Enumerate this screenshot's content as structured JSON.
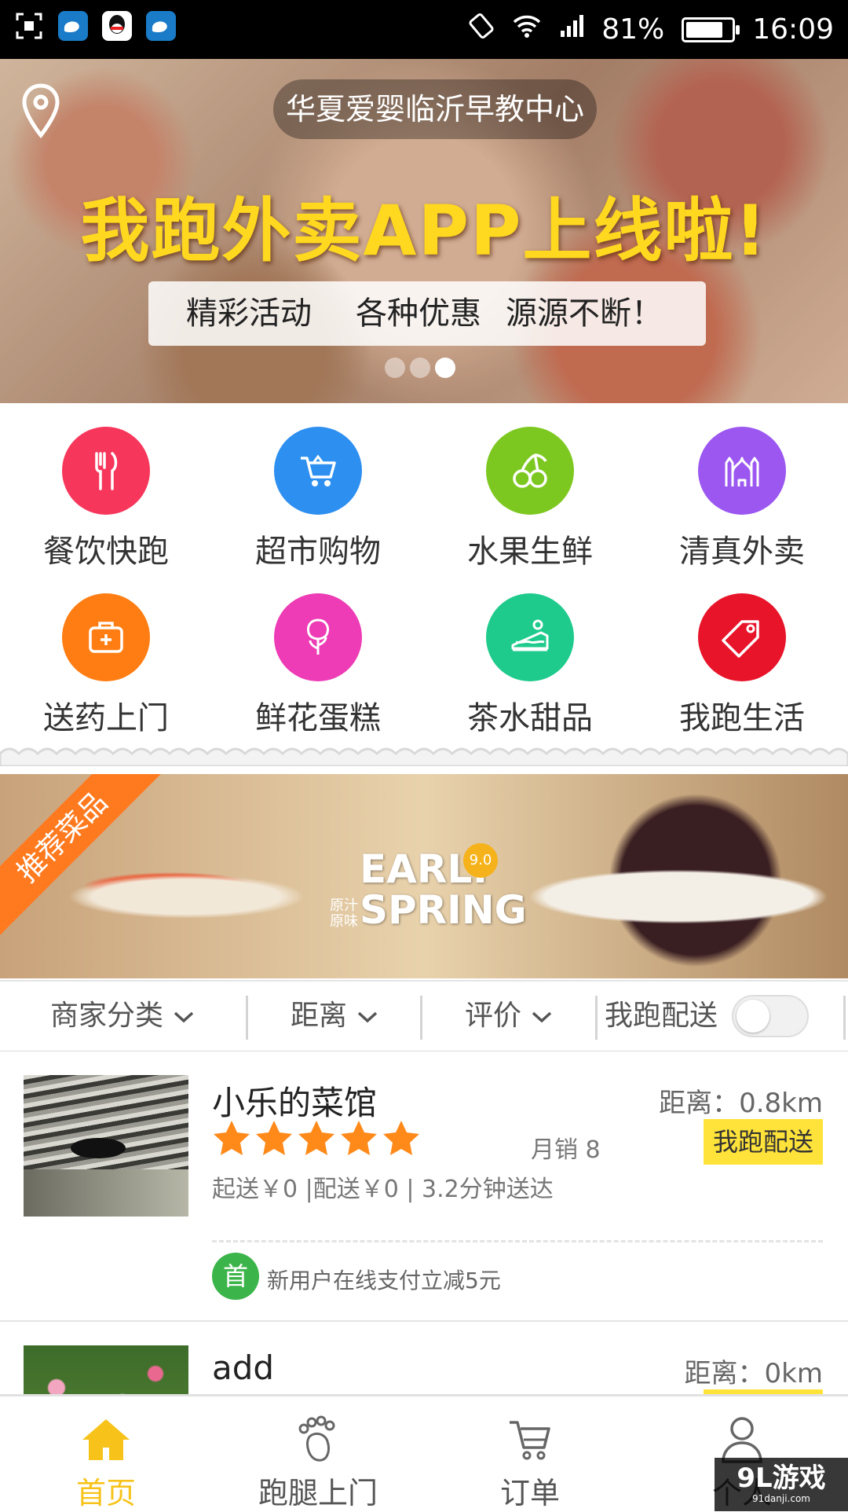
{
  "status_bar": {
    "battery": "81%",
    "time": "16:09",
    "battery_level": 0.81,
    "icons": [
      "screenshot-icon",
      "weibo-icon",
      "qq-icon",
      "weibo-icon",
      "rotation-lock-icon",
      "wifi-icon",
      "signal-icon",
      "battery-icon"
    ]
  },
  "banner": {
    "location": "华夏爱婴临沂早教中心",
    "headline": "我跑外卖APP上线啦!",
    "sub1": "精彩活动",
    "sub2": "各种优惠",
    "sub3": "源源不断！",
    "slide_count": 3,
    "active_slide": 3
  },
  "categories": [
    {
      "label": "餐饮快跑",
      "icon": "fork-knife-icon",
      "color": "#f7365c"
    },
    {
      "label": "超市购物",
      "icon": "shopping-cart-icon",
      "color": "#2d8ff0"
    },
    {
      "label": "水果生鲜",
      "icon": "cherry-icon",
      "color": "#7dc820"
    },
    {
      "label": "清真外卖",
      "icon": "mosque-icon",
      "color": "#9b57f0"
    },
    {
      "label": "送药上门",
      "icon": "medicine-kit-icon",
      "color": "#ff7d12"
    },
    {
      "label": "鲜花蛋糕",
      "icon": "rose-icon",
      "color": "#ed3cb5"
    },
    {
      "label": "茶水甜品",
      "icon": "cake-icon",
      "color": "#1ecb8c"
    },
    {
      "label": "我跑生活",
      "icon": "tag-icon",
      "color": "#e8142a"
    }
  ],
  "promo": {
    "ribbon": "推荐菜品",
    "early": "EARLY",
    "spring": "SPRING",
    "badge": "9.0",
    "side1": "原汁",
    "side2": "原味"
  },
  "filters": {
    "category": "商家分类",
    "distance": "距离",
    "rating": "评价",
    "delivery": "我跑配送",
    "delivery_on": false
  },
  "shops": [
    {
      "name": "小乐的菜馆",
      "distance": "距离：0.8km",
      "rating": 5,
      "monthly_sales": "月销 8",
      "tag": "我跑配送",
      "meta": "起送￥0 |配送￥0 | 3.2分钟送达",
      "badge": "首",
      "promo": "新用户在线支付立减5元"
    },
    {
      "name": "add",
      "distance": "距离：0km"
    }
  ],
  "bottom_nav": [
    {
      "label": "首页",
      "icon": "home-icon",
      "active": true
    },
    {
      "label": "跑腿上门",
      "icon": "footprint-icon",
      "active": false
    },
    {
      "label": "订单",
      "icon": "cart-icon",
      "active": false
    },
    {
      "label": "个人",
      "icon": "user-icon",
      "active": false
    }
  ],
  "watermark": {
    "logo": "9L游戏",
    "url": "91danji.com"
  },
  "colors": {
    "accent": "#f7c31a",
    "tag_yellow": "#ffe33a",
    "star": "#ff8a1a",
    "promo_green": "#3bb54a"
  }
}
